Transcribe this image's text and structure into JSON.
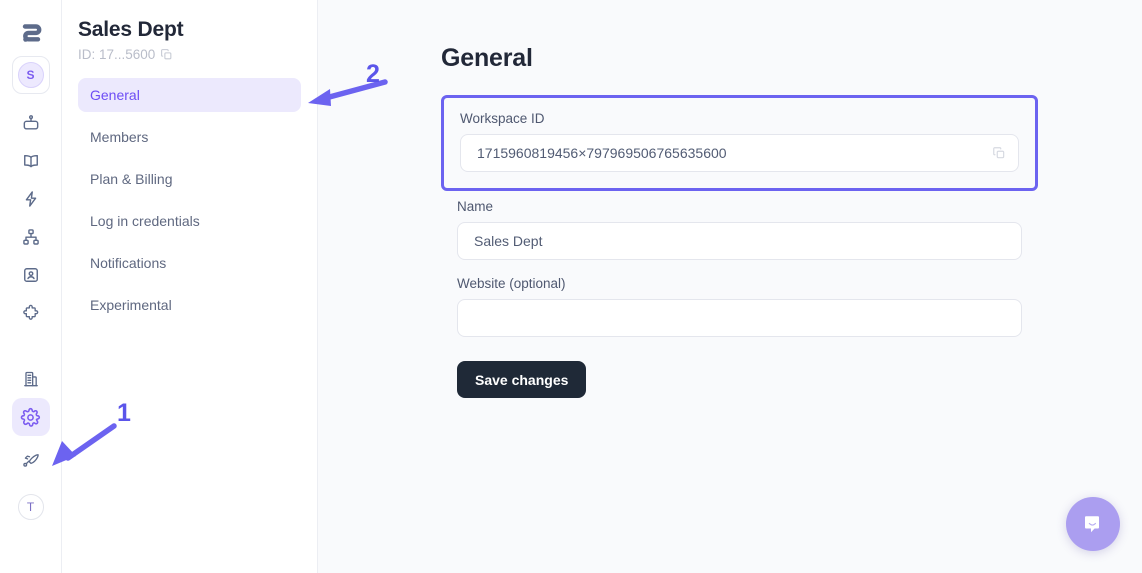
{
  "rail": {
    "logo_name": "brand-logo-s",
    "workspace_avatar_letter": "S",
    "user_avatar_letter": "T",
    "items": [
      {
        "icon": "bot-icon",
        "name": "rail-item-bot"
      },
      {
        "icon": "book-icon",
        "name": "rail-item-knowledge"
      },
      {
        "icon": "lightning-icon",
        "name": "rail-item-automations"
      },
      {
        "icon": "sitemap-icon",
        "name": "rail-item-flows"
      },
      {
        "icon": "contact-card-icon",
        "name": "rail-item-contacts"
      },
      {
        "icon": "puzzle-icon",
        "name": "rail-item-integrations"
      },
      {
        "icon": "building-icon",
        "name": "rail-item-organization"
      },
      {
        "icon": "gear-icon",
        "name": "rail-item-settings",
        "active": true
      },
      {
        "icon": "rocket-icon",
        "name": "rail-item-launch"
      }
    ]
  },
  "nav": {
    "title": "Sales Dept",
    "id_label": "ID: 17...5600",
    "copy_icon": "copy-icon",
    "items": [
      {
        "label": "General",
        "active": true
      },
      {
        "label": "Members",
        "active": false
      },
      {
        "label": "Plan & Billing",
        "active": false
      },
      {
        "label": "Log in credentials",
        "active": false
      },
      {
        "label": "Notifications",
        "active": false
      },
      {
        "label": "Experimental",
        "active": false
      }
    ]
  },
  "main": {
    "page_title": "General",
    "workspace_id": {
      "label": "Workspace ID",
      "value": "1715960819456×797969506765635600",
      "copy_icon": "copy-icon",
      "highlighted": true
    },
    "name": {
      "label": "Name",
      "value": "Sales Dept",
      "placeholder": ""
    },
    "website": {
      "label": "Website (optional)",
      "value": "",
      "placeholder": ""
    },
    "save_label": "Save changes"
  },
  "annotations": [
    {
      "number": "1",
      "target": "rail-item-settings"
    },
    {
      "number": "2",
      "target": "nav-item-general"
    }
  ],
  "intercom": {
    "icon": "chat-bubble-icon"
  },
  "colors": {
    "accent": "#6c63f0",
    "annotation": "#5b55ea",
    "active_nav_bg": "#ece9fd",
    "active_nav_text": "#6d4df5",
    "save_button_bg": "#1f2937",
    "main_bg": "#f9fafc",
    "intercom_bg": "#ab9ef0"
  }
}
